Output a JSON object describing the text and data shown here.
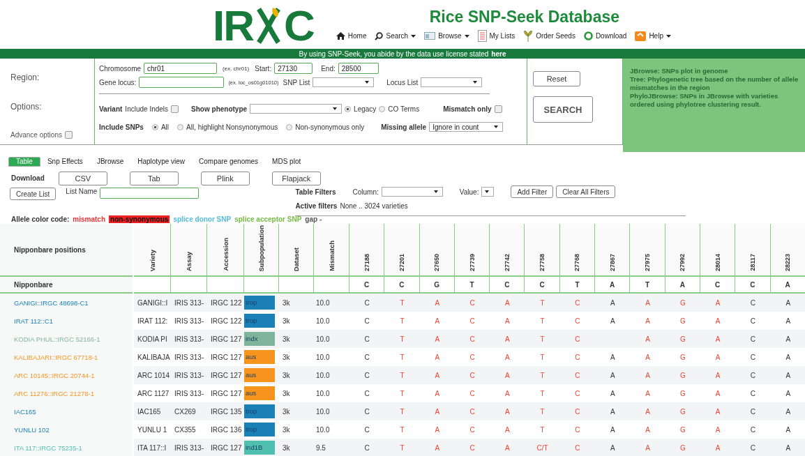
{
  "logo": {
    "left": "IR",
    "right": "C"
  },
  "site_title": "Rice SNP-Seek Database",
  "nav": [
    {
      "label": "Home",
      "caret": false
    },
    {
      "label": "Search",
      "caret": true
    },
    {
      "label": "Browse",
      "caret": true
    },
    {
      "label": "My Lists",
      "caret": false
    },
    {
      "label": "Order Seeds",
      "caret": false
    },
    {
      "label": "Download",
      "caret": false
    },
    {
      "label": "Help",
      "caret": true
    }
  ],
  "notice": {
    "text": "By using SNP-Seek, you abide by the data use license stated",
    "link": "here"
  },
  "form": {
    "region_label": "Region:",
    "options_label": "Options:",
    "advance_options": {
      "label": "Advance options",
      "checked": false
    },
    "chromosome": {
      "label": "Chromosome",
      "value": "chr01",
      "hint": "(ex. chr01)"
    },
    "start": {
      "label": "Start:",
      "value": "27130"
    },
    "end": {
      "label": "End:",
      "value": "28500"
    },
    "gene_locus": {
      "label": "Gene locus:",
      "hint": "(ex. loc_os01g01010)"
    },
    "snp_list": {
      "label": "SNP List"
    },
    "locus_list": {
      "label": "Locus List"
    },
    "variant": {
      "label": "Variant",
      "include_indels": {
        "label": "Include Indels",
        "checked": false
      }
    },
    "show_phenotype": {
      "label": "Show phenotype"
    },
    "phenotype_radios": [
      {
        "label": "Legacy",
        "selected": true
      },
      {
        "label": "CO Terms",
        "selected": false
      }
    ],
    "mismatch_only": {
      "label": "Mismatch only",
      "checked": false
    },
    "include_snps": {
      "label": "Include SNPs",
      "options": [
        {
          "label": "All",
          "selected": true
        },
        {
          "label": "All, highlight Nonsynonymous",
          "selected": false
        },
        {
          "label": "Non-synonymous only",
          "selected": false
        }
      ]
    },
    "missing_allele": {
      "label": "Missing allele",
      "value": "Ignore in count"
    },
    "buttons": [
      "Reset",
      "SEARCH"
    ]
  },
  "help_panel": [
    "JBrowse: SNPs plot in genome",
    "Tree: Phylogenetic tree based on the number of allele mismatches in the region",
    "PhyloJBrowse: SNPs in JBrowse with varieties ordered using phylotree clustering result."
  ],
  "tabs": [
    {
      "label": "Table",
      "selected": true
    },
    {
      "label": "Snp Effects",
      "selected": false
    },
    {
      "label": "JBrowse",
      "selected": false
    },
    {
      "label": "Haplotype view",
      "selected": false
    },
    {
      "label": "Compare genomes",
      "selected": false
    },
    {
      "label": "MDS plot",
      "selected": false
    }
  ],
  "download": {
    "label": "Download",
    "buttons": [
      "CSV",
      "Tab",
      "Plink",
      "Flapjack"
    ]
  },
  "list": {
    "button": "Create List",
    "label": "List Name"
  },
  "filters": {
    "label": "Table Filters",
    "column_label": "Column:",
    "value_label": "Value:",
    "buttons": [
      "Add Filter",
      "Clear All Filters"
    ],
    "active_label": "Active filters",
    "active_value": "None .. 3024 varieties"
  },
  "legend": {
    "label": "Allele color code:",
    "items": [
      {
        "label": "mismatch",
        "kind": "text",
        "color": "#ee3333"
      },
      {
        "label": "non-synonymous",
        "kind": "block",
        "color": "#ee2222"
      },
      {
        "label": "splice donor SNP",
        "kind": "text",
        "color": "#55bbdd"
      },
      {
        "label": "splice acceptor SNP",
        "kind": "text",
        "color": "#77bb44"
      },
      {
        "label": "gap -",
        "kind": "text",
        "color": "#555555"
      }
    ]
  },
  "table": {
    "positions_label": "Nipponbare positions",
    "reference_label": "Nipponbare",
    "columns": [
      "Variety",
      "Assay",
      "Accession",
      "Subpopulation",
      "Dataset",
      "Mismatch"
    ],
    "positions": [
      "27188",
      "27201",
      "27650",
      "27739",
      "27742",
      "27758",
      "27768",
      "27867",
      "27975",
      "27992",
      "28014",
      "28117",
      "28223"
    ],
    "reference": [
      "C",
      "C",
      "G",
      "T",
      "C",
      "C",
      "T",
      "A",
      "T",
      "A",
      "C",
      "C",
      "A"
    ],
    "rows": [
      {
        "name": "GANIGI::IRGC 48698-C1",
        "variety": "GANIGI::I",
        "assay": "IRIS 313-",
        "accession": "IRGC 122",
        "subpopulation": "trop",
        "color": "#1a80b6",
        "dataset": "3k",
        "mismatch": "10.0",
        "alleles": [
          {
            "allele": "C",
            "mismatch": false
          },
          {
            "allele": "T",
            "mismatch": true
          },
          {
            "allele": "A",
            "mismatch": true
          },
          {
            "allele": "C",
            "mismatch": true
          },
          {
            "allele": "A",
            "mismatch": true
          },
          {
            "allele": "T",
            "mismatch": true
          },
          {
            "allele": "C",
            "mismatch": true
          },
          {
            "allele": "A",
            "mismatch": false
          },
          {
            "allele": "A",
            "mismatch": true
          },
          {
            "allele": "G",
            "mismatch": true
          },
          {
            "allele": "A",
            "mismatch": true
          },
          {
            "allele": "C",
            "mismatch": false
          },
          {
            "allele": "A",
            "mismatch": false
          }
        ]
      },
      {
        "name": "IRAT 112::C1",
        "variety": "IRAT 112:",
        "assay": "IRIS 313-",
        "accession": "IRGC 122",
        "subpopulation": "trop",
        "color": "#1a80b6",
        "dataset": "3k",
        "mismatch": "10.0",
        "alleles": [
          {
            "allele": "C",
            "mismatch": false
          },
          {
            "allele": "T",
            "mismatch": true
          },
          {
            "allele": "A",
            "mismatch": true
          },
          {
            "allele": "C",
            "mismatch": true
          },
          {
            "allele": "A",
            "mismatch": true
          },
          {
            "allele": "T",
            "mismatch": true
          },
          {
            "allele": "C",
            "mismatch": true
          },
          {
            "allele": "A",
            "mismatch": false
          },
          {
            "allele": "A",
            "mismatch": true
          },
          {
            "allele": "G",
            "mismatch": true
          },
          {
            "allele": "A",
            "mismatch": true
          },
          {
            "allele": "C",
            "mismatch": false
          },
          {
            "allele": "A",
            "mismatch": false
          }
        ]
      },
      {
        "name": "KODIA PHUL::IRGC 52166-1",
        "variety": "KODIA PI",
        "assay": "IRIS 313-",
        "accession": "IRGC 127",
        "subpopulation": "indx",
        "color": "#7fb59a",
        "dataset": "3k",
        "mismatch": "10.0",
        "alleles": [
          {
            "allele": "C",
            "mismatch": false
          },
          {
            "allele": "T",
            "mismatch": true
          },
          {
            "allele": "A",
            "mismatch": true
          },
          {
            "allele": "C",
            "mismatch": true
          },
          {
            "allele": "A",
            "mismatch": true
          },
          {
            "allele": "T",
            "mismatch": true
          },
          {
            "allele": "C",
            "mismatch": true
          },
          {
            "missing": true
          },
          {
            "allele": "A",
            "mismatch": true
          },
          {
            "allele": "G",
            "mismatch": true
          },
          {
            "allele": "A",
            "mismatch": true
          },
          {
            "allele": "C",
            "mismatch": false
          },
          {
            "allele": "A",
            "mismatch": false
          }
        ]
      },
      {
        "name": "KALIBAJARI::IRGC 67718-1",
        "variety": "KALIBAJA",
        "assay": "IRIS 313-",
        "accession": "IRGC 127",
        "subpopulation": "aus",
        "color": "#f7941d",
        "dataset": "3k",
        "mismatch": "10.0",
        "alleles": [
          {
            "allele": "C",
            "mismatch": false
          },
          {
            "allele": "T",
            "mismatch": true
          },
          {
            "allele": "A",
            "mismatch": true
          },
          {
            "allele": "C",
            "mismatch": true
          },
          {
            "allele": "A",
            "mismatch": true
          },
          {
            "allele": "T",
            "mismatch": true
          },
          {
            "allele": "C",
            "mismatch": true
          },
          {
            "allele": "A",
            "mismatch": false
          },
          {
            "allele": "A",
            "mismatch": true
          },
          {
            "allele": "G",
            "mismatch": true
          },
          {
            "allele": "A",
            "mismatch": true
          },
          {
            "allele": "C",
            "mismatch": false
          },
          {
            "allele": "A",
            "mismatch": false
          }
        ]
      },
      {
        "name": "ARC 10145::IRGC 20744-1",
        "variety": "ARC 1014",
        "assay": "IRIS 313-",
        "accession": "IRGC 127",
        "subpopulation": "aus",
        "color": "#f7941d",
        "dataset": "3k",
        "mismatch": "10.0",
        "alleles": [
          {
            "allele": "C",
            "mismatch": false
          },
          {
            "allele": "T",
            "mismatch": true
          },
          {
            "allele": "A",
            "mismatch": true
          },
          {
            "allele": "C",
            "mismatch": true
          },
          {
            "allele": "A",
            "mismatch": true
          },
          {
            "allele": "T",
            "mismatch": true
          },
          {
            "allele": "C",
            "mismatch": true
          },
          {
            "allele": "A",
            "mismatch": false
          },
          {
            "allele": "A",
            "mismatch": true
          },
          {
            "allele": "G",
            "mismatch": true
          },
          {
            "allele": "A",
            "mismatch": true
          },
          {
            "allele": "C",
            "mismatch": false
          },
          {
            "allele": "A",
            "mismatch": false
          }
        ]
      },
      {
        "name": "ARC 11276::IRGC 21278-1",
        "variety": "ARC 1127",
        "assay": "IRIS 313-",
        "accession": "IRGC 127",
        "subpopulation": "aus",
        "color": "#f7941d",
        "dataset": "3k",
        "mismatch": "10.0",
        "alleles": [
          {
            "allele": "C",
            "mismatch": false
          },
          {
            "allele": "T",
            "mismatch": true
          },
          {
            "allele": "A",
            "mismatch": true
          },
          {
            "allele": "C",
            "mismatch": true
          },
          {
            "allele": "A",
            "mismatch": true
          },
          {
            "allele": "T",
            "mismatch": true
          },
          {
            "allele": "C",
            "mismatch": true
          },
          {
            "allele": "A",
            "mismatch": false
          },
          {
            "allele": "A",
            "mismatch": true
          },
          {
            "allele": "G",
            "mismatch": true
          },
          {
            "allele": "A",
            "mismatch": true
          },
          {
            "allele": "C",
            "mismatch": false
          },
          {
            "allele": "A",
            "mismatch": false
          }
        ]
      },
      {
        "name": "IAC165",
        "variety": "IAC165",
        "assay": "CX269",
        "accession": "IRGC 135",
        "subpopulation": "trop",
        "color": "#1a80b6",
        "dataset": "3k",
        "mismatch": "10.0",
        "alleles": [
          {
            "allele": "C",
            "mismatch": false
          },
          {
            "allele": "T",
            "mismatch": true
          },
          {
            "allele": "A",
            "mismatch": true
          },
          {
            "allele": "C",
            "mismatch": true
          },
          {
            "allele": "A",
            "mismatch": true
          },
          {
            "allele": "T",
            "mismatch": true
          },
          {
            "allele": "C",
            "mismatch": true
          },
          {
            "allele": "A",
            "mismatch": false
          },
          {
            "allele": "A",
            "mismatch": true
          },
          {
            "allele": "G",
            "mismatch": true
          },
          {
            "allele": "A",
            "mismatch": true
          },
          {
            "allele": "C",
            "mismatch": false
          },
          {
            "allele": "A",
            "mismatch": false
          }
        ]
      },
      {
        "name": "YUNLU 102",
        "variety": "YUNLU 1",
        "assay": "CX355",
        "accession": "IRGC 136",
        "subpopulation": "trop",
        "color": "#1a80b6",
        "dataset": "3k",
        "mismatch": "10.0",
        "alleles": [
          {
            "allele": "C",
            "mismatch": false
          },
          {
            "allele": "T",
            "mismatch": true
          },
          {
            "allele": "A",
            "mismatch": true
          },
          {
            "allele": "C",
            "mismatch": true
          },
          {
            "allele": "A",
            "mismatch": true
          },
          {
            "allele": "T",
            "mismatch": true
          },
          {
            "allele": "C",
            "mismatch": true
          },
          {
            "allele": "A",
            "mismatch": false
          },
          {
            "allele": "A",
            "mismatch": true
          },
          {
            "allele": "G",
            "mismatch": true
          },
          {
            "allele": "A",
            "mismatch": true
          },
          {
            "allele": "C",
            "mismatch": false
          },
          {
            "allele": "A",
            "mismatch": false
          }
        ]
      },
      {
        "name": "ITA 117::IRGC 75235-1",
        "variety": "ITA 117::I",
        "assay": "IRIS 313-",
        "accession": "IRGC 127",
        "subpopulation": "ind1B",
        "color": "#4fc0b0",
        "dataset": "3k",
        "mismatch": "9.5",
        "alleles": [
          {
            "allele": "C",
            "mismatch": false
          },
          {
            "allele": "T",
            "mismatch": true
          },
          {
            "allele": "A",
            "mismatch": true
          },
          {
            "allele": "C",
            "mismatch": true
          },
          {
            "allele": "A",
            "mismatch": true
          },
          {
            "allele": "C/T",
            "mismatch": true
          },
          {
            "allele": "C",
            "mismatch": true
          },
          {
            "allele": "A",
            "mismatch": false
          },
          {
            "allele": "A",
            "mismatch": true
          },
          {
            "allele": "G",
            "mismatch": true
          },
          {
            "allele": "A",
            "mismatch": true
          },
          {
            "allele": "C",
            "mismatch": false
          },
          {
            "allele": "A",
            "mismatch": false
          }
        ]
      }
    ]
  }
}
